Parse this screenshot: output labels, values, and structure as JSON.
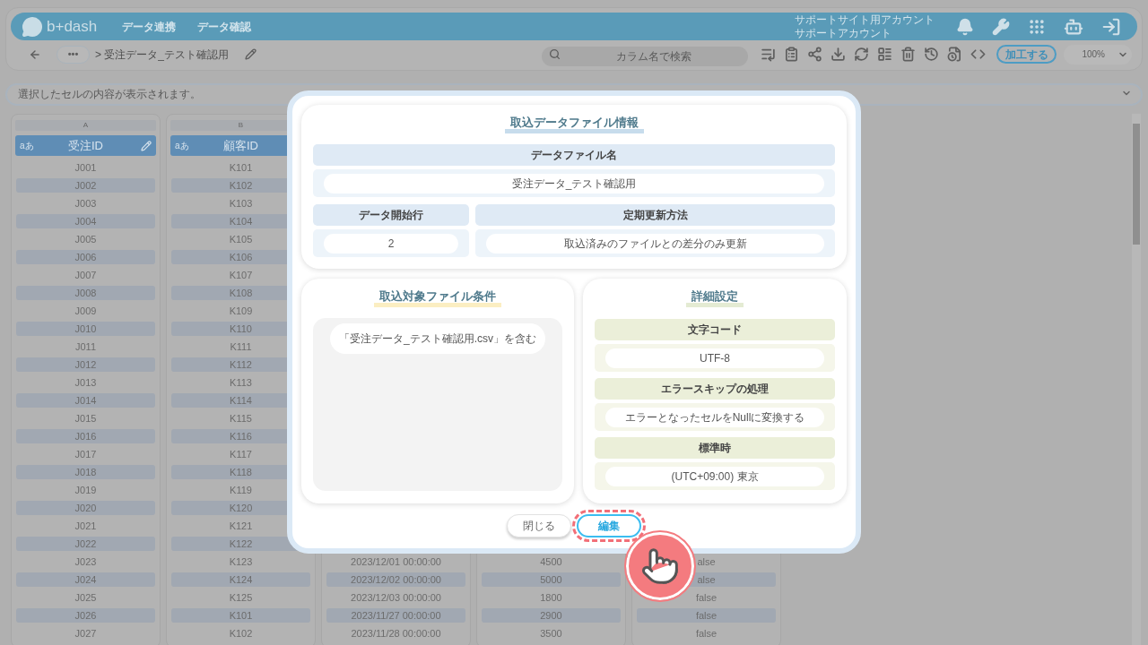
{
  "header": {
    "logo": "b+dash",
    "nav": [
      {
        "label": "データ連携"
      },
      {
        "label": "データ確認"
      }
    ],
    "account": [
      "サポートサイト用アカウント",
      "サポートアカウント"
    ]
  },
  "toolbar": {
    "more": "•••",
    "breadcrumb": "> 受注データ_テスト確認用",
    "search": {
      "placeholder": "カラム名で検索"
    },
    "process_button": "加工する",
    "zoom": "100%"
  },
  "cell_bar": {
    "placeholder": "選択したセルの内容が表示されます。"
  },
  "table": {
    "columns": [
      {
        "letter": "A",
        "type_label": "aあ",
        "name": "受注ID",
        "edit_icon": true
      },
      {
        "letter": "B",
        "type_label": "aあ",
        "name": "顧客ID"
      }
    ],
    "rows": [
      {
        "cells": [
          "J001",
          "K101"
        ]
      },
      {
        "cells": [
          "J002",
          "K102"
        ]
      },
      {
        "cells": [
          "J003",
          "K103"
        ]
      },
      {
        "cells": [
          "J004",
          "K104"
        ]
      },
      {
        "cells": [
          "J005",
          "K105"
        ]
      },
      {
        "cells": [
          "J006",
          "K106"
        ]
      },
      {
        "cells": [
          "J007",
          "K107"
        ]
      },
      {
        "cells": [
          "J008",
          "K108"
        ]
      },
      {
        "cells": [
          "J009",
          "K109"
        ]
      },
      {
        "cells": [
          "J010",
          "K110"
        ]
      },
      {
        "cells": [
          "J011",
          "K111"
        ]
      },
      {
        "cells": [
          "J012",
          "K112"
        ]
      },
      {
        "cells": [
          "J013",
          "K113"
        ]
      },
      {
        "cells": [
          "J014",
          "K114"
        ]
      },
      {
        "cells": [
          "J015",
          "K115"
        ]
      },
      {
        "cells": [
          "J016",
          "K116"
        ]
      },
      {
        "cells": [
          "J017",
          "K117"
        ]
      },
      {
        "cells": [
          "J018",
          "K118"
        ]
      },
      {
        "cells": [
          "J019",
          "K119"
        ]
      },
      {
        "cells": [
          "J020",
          "K120"
        ]
      },
      {
        "cells": [
          "J021",
          "K121"
        ]
      },
      {
        "cells": [
          "J022",
          "K122"
        ]
      },
      {
        "cells": [
          "J023",
          "K123",
          "2023/12/01 00:00:00",
          "4500",
          "alse"
        ]
      },
      {
        "cells": [
          "J024",
          "K124",
          "2023/12/02 00:00:00",
          "5000",
          "alse"
        ]
      },
      {
        "cells": [
          "J025",
          "K125",
          "2023/12/03 00:00:00",
          "1800",
          "false"
        ]
      },
      {
        "cells": [
          "J026",
          "K101",
          "2023/11/27 00:00:00",
          "2900",
          "false"
        ]
      },
      {
        "cells": [
          "J027",
          "K102",
          "2023/11/28 00:00:00",
          "3500",
          "false"
        ]
      }
    ]
  },
  "dialog": {
    "file_info": {
      "title": "取込データファイル情報",
      "fields": [
        {
          "label": "データファイル名",
          "value": "受注データ_テスト確認用"
        },
        {
          "label": "データ開始行",
          "value": "2"
        },
        {
          "label": "定期更新方法",
          "value": "取込済みのファイルとの差分のみ更新"
        }
      ]
    },
    "file_conditions": {
      "title": "取込対象ファイル条件",
      "conditions": [
        "「受注データ_テスト確認用.csv」を含む"
      ]
    },
    "details": {
      "title": "詳細設定",
      "fields": [
        {
          "label": "文字コード",
          "value": "UTF-8"
        },
        {
          "label": "エラースキップの処理",
          "value": "エラーとなったセルをNullに変換する"
        },
        {
          "label": "標準時",
          "value": "(UTC+09:00) 東京"
        }
      ]
    },
    "buttons": [
      {
        "label": "閉じる",
        "kind": "secondary",
        "highlighted": false
      },
      {
        "label": "編集",
        "kind": "primary",
        "highlighted": true
      }
    ]
  }
}
